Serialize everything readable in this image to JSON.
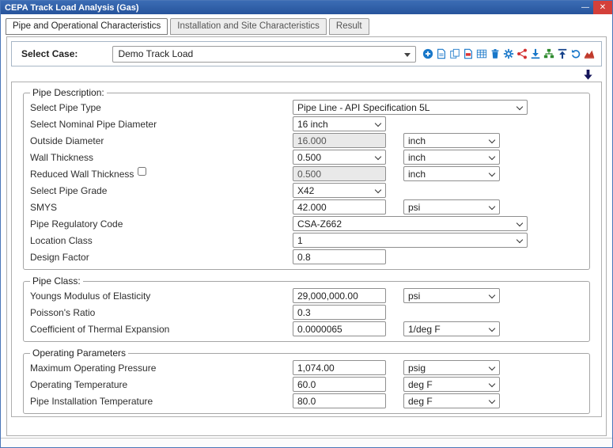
{
  "window": {
    "title": "CEPA Track Load Analysis (Gas)",
    "minimize": "—",
    "close": "✕"
  },
  "tabs": [
    {
      "label": "Pipe and Operational Characteristics",
      "active": true
    },
    {
      "label": "Installation and Site Characteristics",
      "active": false
    },
    {
      "label": "Result",
      "active": false
    }
  ],
  "case": {
    "label": "Select Case:",
    "value": "Demo Track Load"
  },
  "toolbar": {
    "icons": [
      "add",
      "save",
      "copy",
      "export-pdf",
      "table",
      "delete",
      "settings",
      "share",
      "download",
      "tree-view",
      "upload",
      "undo",
      "chart"
    ]
  },
  "colors": {
    "accent_blue": "#1877c9",
    "icon_red": "#d32f2f",
    "icon_green": "#2e8b2e",
    "icon_dark": "#15428b",
    "titlebar": "#2b5ca8",
    "close_red": "#d4403a"
  },
  "sections": {
    "pipe_description": {
      "legend": "Pipe Description:",
      "rows": {
        "pipe_type": {
          "label": "Select Pipe Type",
          "value": "Pipe Line - API Specification 5L"
        },
        "nominal_diameter": {
          "label": "Select Nominal Pipe Diameter",
          "value": "16 inch"
        },
        "outside_diameter": {
          "label": "Outside Diameter",
          "value": "16.000",
          "unit": "inch"
        },
        "wall_thickness": {
          "label": "Wall Thickness",
          "value": "0.500",
          "unit": "inch"
        },
        "reduced_wall_thickness": {
          "label": "Reduced Wall Thickness",
          "value": "0.500",
          "unit": "inch",
          "checked": false
        },
        "pipe_grade": {
          "label": "Select Pipe Grade",
          "value": "X42"
        },
        "smys": {
          "label": "SMYS",
          "value": "42.000",
          "unit": "psi"
        },
        "regulatory_code": {
          "label": "Pipe Regulatory Code",
          "value": "CSA-Z662"
        },
        "location_class": {
          "label": "Location Class",
          "value": "1"
        },
        "design_factor": {
          "label": "Design Factor",
          "value": "0.8"
        }
      }
    },
    "pipe_class": {
      "legend": "Pipe Class:",
      "rows": {
        "youngs_modulus": {
          "label": "Youngs Modulus of Elasticity",
          "value": "29,000,000.00",
          "unit": "psi"
        },
        "poissons_ratio": {
          "label": "Poisson's Ratio",
          "value": "0.3"
        },
        "thermal_expansion": {
          "label": "Coefficient of Thermal Expansion",
          "value": "0.0000065",
          "unit": "1/deg F"
        }
      }
    },
    "operating_parameters": {
      "legend": "Operating Parameters",
      "rows": {
        "max_pressure": {
          "label": "Maximum Operating Pressure",
          "value": "1,074.00",
          "unit": "psig"
        },
        "op_temp": {
          "label": "Operating Temperature",
          "value": "60.0",
          "unit": "deg F"
        },
        "install_temp": {
          "label": "Pipe Installation Temperature",
          "value": "80.0",
          "unit": "deg F"
        }
      }
    }
  }
}
